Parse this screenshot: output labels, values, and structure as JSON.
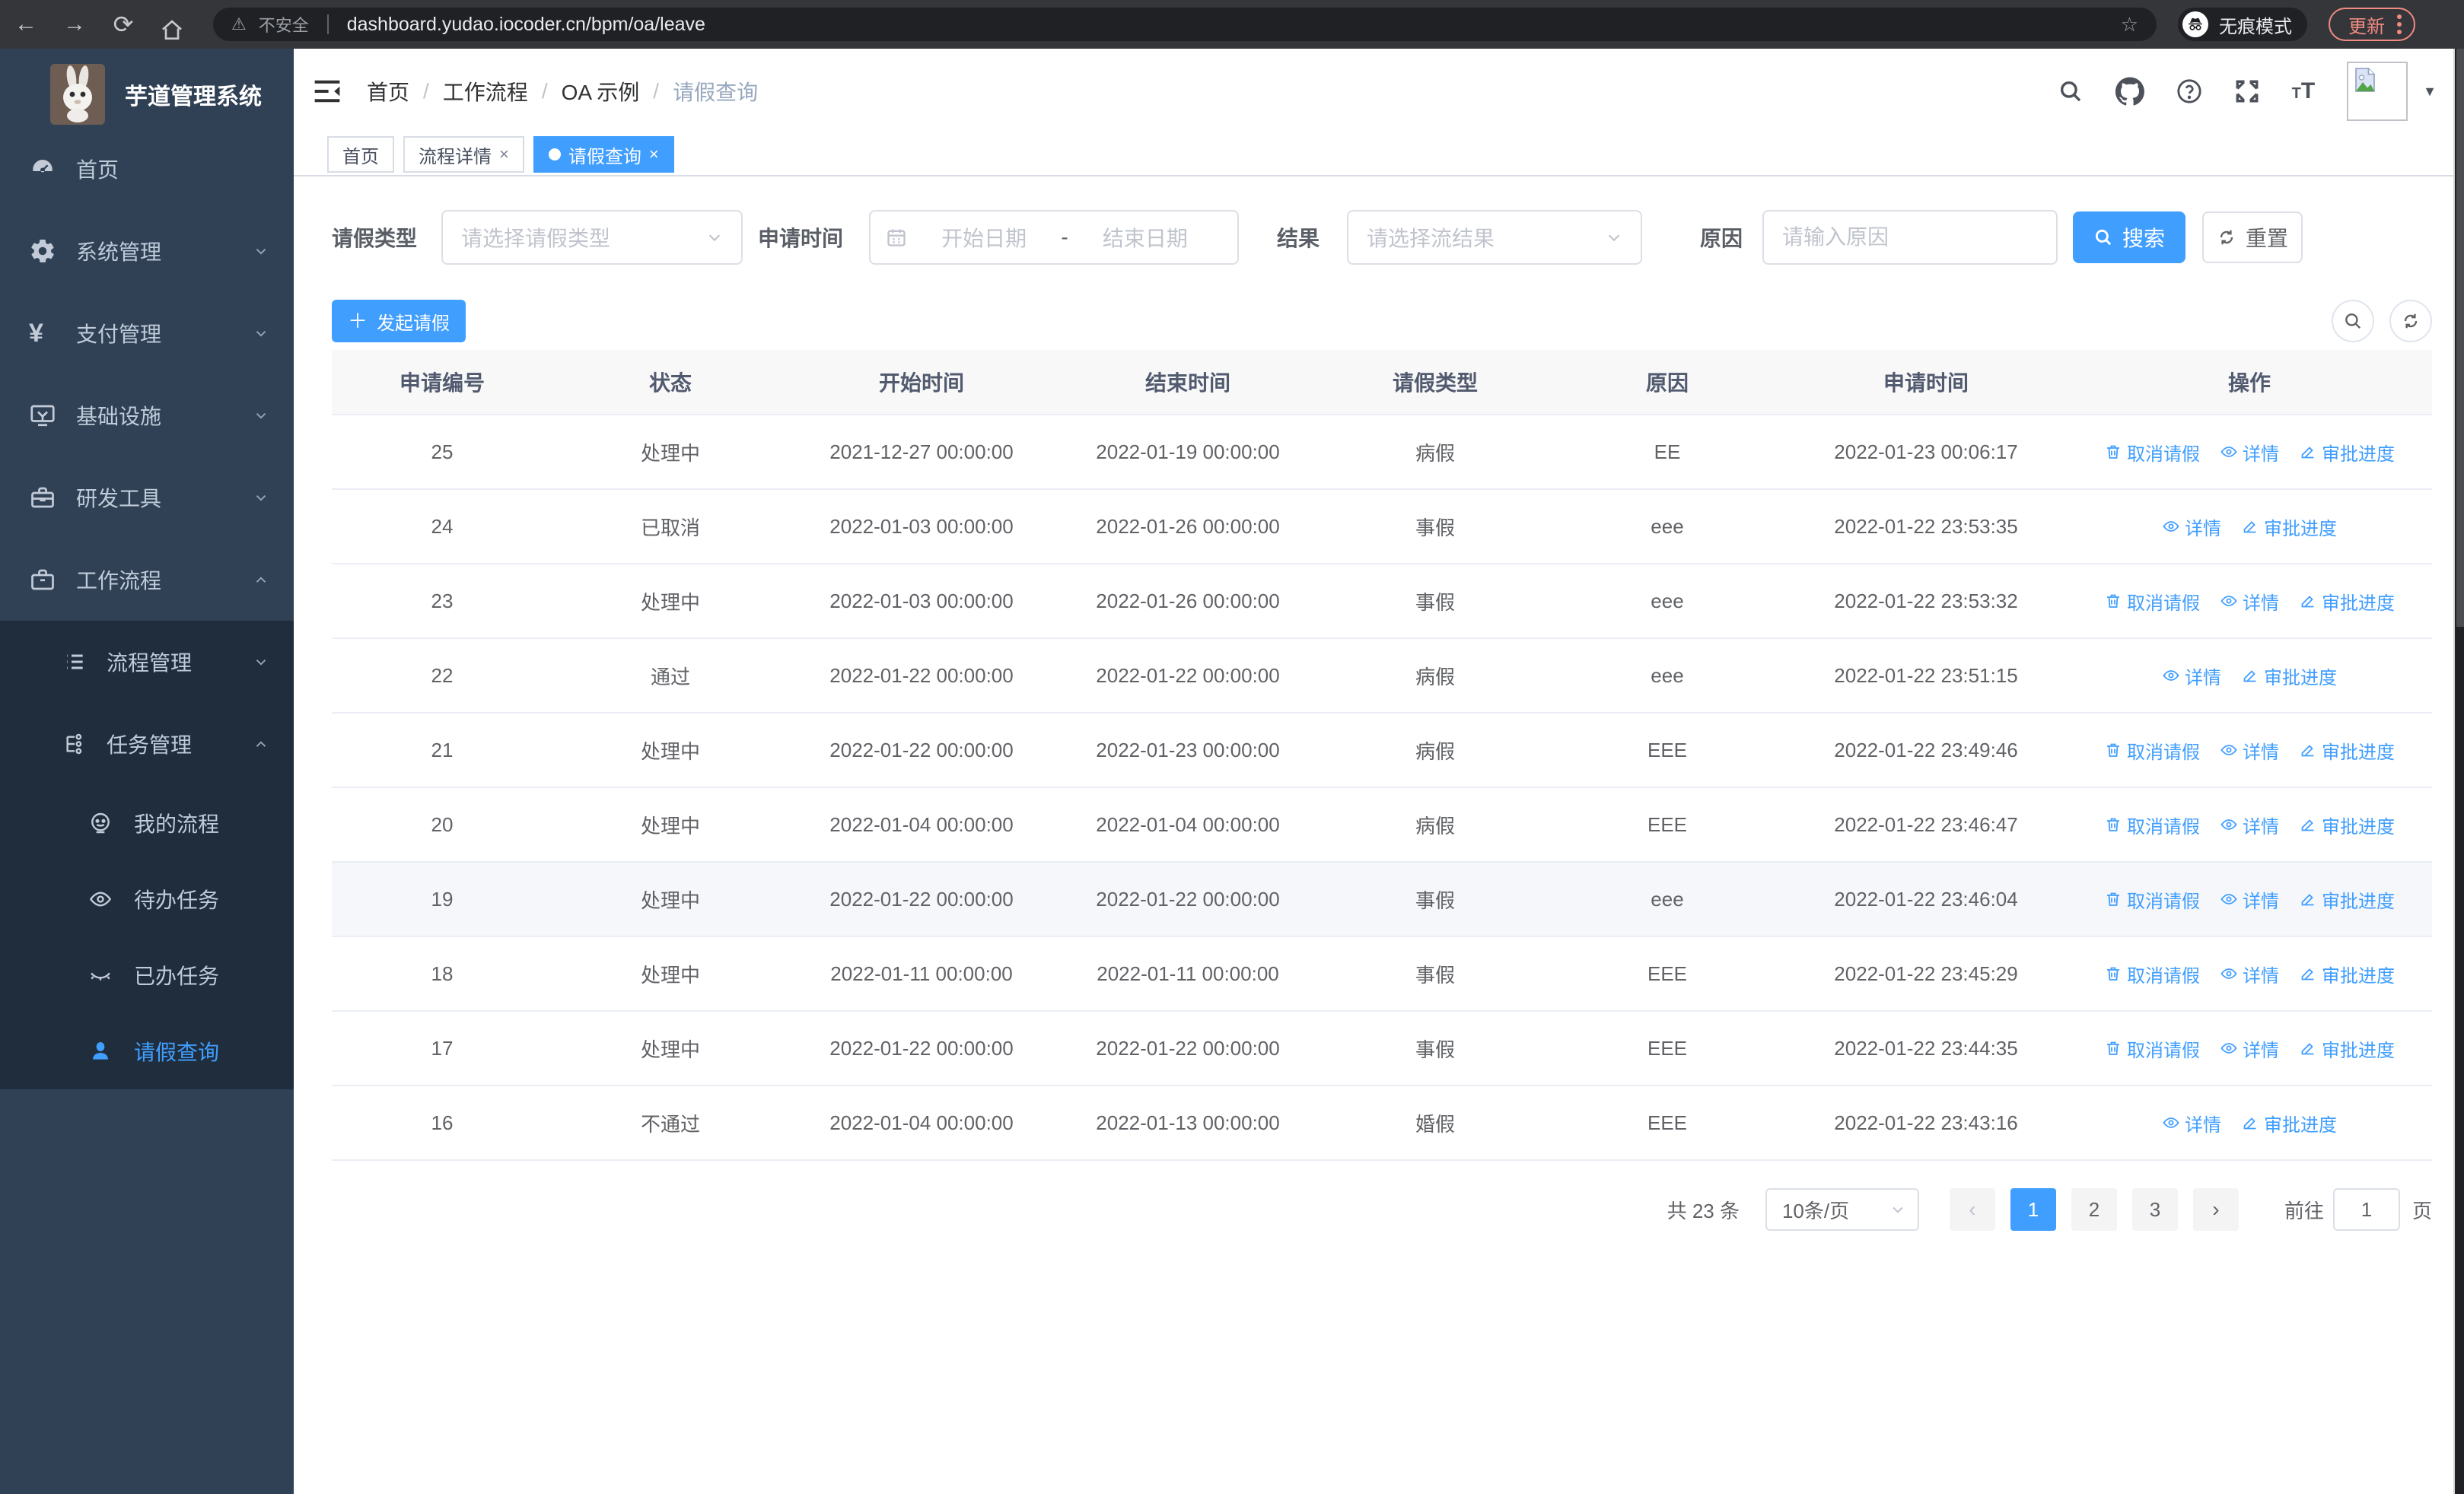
{
  "browser": {
    "security_warning": "不安全",
    "url": "dashboard.yudao.iocoder.cn/bpm/oa/leave",
    "incognito_label": "无痕模式",
    "update_label": "更新"
  },
  "sidebar": {
    "app_title": "芋道管理系统",
    "menu": [
      {
        "label": "首页",
        "icon": "dashboard-icon",
        "level": 1,
        "chevron": "",
        "active": false
      },
      {
        "label": "系统管理",
        "icon": "gear-icon",
        "level": 1,
        "chevron": "down",
        "active": false
      },
      {
        "label": "支付管理",
        "icon": "yen-icon",
        "level": 1,
        "chevron": "down",
        "active": false
      },
      {
        "label": "基础设施",
        "icon": "monitor-icon",
        "level": 1,
        "chevron": "down",
        "active": false
      },
      {
        "label": "研发工具",
        "icon": "toolbox-icon",
        "level": 1,
        "chevron": "down",
        "active": false
      },
      {
        "label": "工作流程",
        "icon": "briefcase-icon",
        "level": 1,
        "chevron": "up",
        "active": false
      },
      {
        "label": "流程管理",
        "icon": "list-icon",
        "level": 2,
        "chevron": "down",
        "active": false
      },
      {
        "label": "任务管理",
        "icon": "flow-icon",
        "level": 2,
        "chevron": "up",
        "active": false
      },
      {
        "label": "我的流程",
        "icon": "face-icon",
        "level": 3,
        "chevron": "",
        "active": false
      },
      {
        "label": "待办任务",
        "icon": "eye-open-icon",
        "level": 3,
        "chevron": "",
        "active": false
      },
      {
        "label": "已办任务",
        "icon": "eye-closed-icon",
        "level": 3,
        "chevron": "",
        "active": false
      },
      {
        "label": "请假查询",
        "icon": "user-icon",
        "level": 3,
        "chevron": "",
        "active": true
      }
    ]
  },
  "header": {
    "breadcrumb": [
      "首页",
      "工作流程",
      "OA 示例",
      "请假查询"
    ]
  },
  "tabs": [
    {
      "label": "首页",
      "closable": false,
      "active": false
    },
    {
      "label": "流程详情",
      "closable": true,
      "active": false
    },
    {
      "label": "请假查询",
      "closable": true,
      "active": true
    }
  ],
  "filters": {
    "type_label": "请假类型",
    "type_placeholder": "请选择请假类型",
    "time_label": "申请时间",
    "start_placeholder": "开始日期",
    "range_separator": "-",
    "end_placeholder": "结束日期",
    "result_label": "结果",
    "result_placeholder": "请选择流结果",
    "reason_label": "原因",
    "reason_placeholder": "请输入原因",
    "search_label": "搜索",
    "reset_label": "重置"
  },
  "toolbar": {
    "create_label": "发起请假"
  },
  "table": {
    "columns": [
      "申请编号",
      "状态",
      "开始时间",
      "结束时间",
      "请假类型",
      "原因",
      "申请时间",
      "操作"
    ],
    "action_labels": {
      "cancel": "取消请假",
      "detail": "详情",
      "progress": "审批进度"
    },
    "rows": [
      {
        "id": "25",
        "status": "处理中",
        "start": "2021-12-27 00:00:00",
        "end": "2022-01-19 00:00:00",
        "type": "病假",
        "reason": "EE",
        "applied": "2022-01-23 00:06:17",
        "actions": [
          "cancel",
          "detail",
          "progress"
        ],
        "highlight": false
      },
      {
        "id": "24",
        "status": "已取消",
        "start": "2022-01-03 00:00:00",
        "end": "2022-01-26 00:00:00",
        "type": "事假",
        "reason": "eee",
        "applied": "2022-01-22 23:53:35",
        "actions": [
          "detail",
          "progress"
        ],
        "highlight": false
      },
      {
        "id": "23",
        "status": "处理中",
        "start": "2022-01-03 00:00:00",
        "end": "2022-01-26 00:00:00",
        "type": "事假",
        "reason": "eee",
        "applied": "2022-01-22 23:53:32",
        "actions": [
          "cancel",
          "detail",
          "progress"
        ],
        "highlight": false
      },
      {
        "id": "22",
        "status": "通过",
        "start": "2022-01-22 00:00:00",
        "end": "2022-01-22 00:00:00",
        "type": "病假",
        "reason": "eee",
        "applied": "2022-01-22 23:51:15",
        "actions": [
          "detail",
          "progress"
        ],
        "highlight": false
      },
      {
        "id": "21",
        "status": "处理中",
        "start": "2022-01-22 00:00:00",
        "end": "2022-01-23 00:00:00",
        "type": "病假",
        "reason": "EEE",
        "applied": "2022-01-22 23:49:46",
        "actions": [
          "cancel",
          "detail",
          "progress"
        ],
        "highlight": false
      },
      {
        "id": "20",
        "status": "处理中",
        "start": "2022-01-04 00:00:00",
        "end": "2022-01-04 00:00:00",
        "type": "病假",
        "reason": "EEE",
        "applied": "2022-01-22 23:46:47",
        "actions": [
          "cancel",
          "detail",
          "progress"
        ],
        "highlight": false
      },
      {
        "id": "19",
        "status": "处理中",
        "start": "2022-01-22 00:00:00",
        "end": "2022-01-22 00:00:00",
        "type": "事假",
        "reason": "eee",
        "applied": "2022-01-22 23:46:04",
        "actions": [
          "cancel",
          "detail",
          "progress"
        ],
        "highlight": true
      },
      {
        "id": "18",
        "status": "处理中",
        "start": "2022-01-11 00:00:00",
        "end": "2022-01-11 00:00:00",
        "type": "事假",
        "reason": "EEE",
        "applied": "2022-01-22 23:45:29",
        "actions": [
          "cancel",
          "detail",
          "progress"
        ],
        "highlight": false
      },
      {
        "id": "17",
        "status": "处理中",
        "start": "2022-01-22 00:00:00",
        "end": "2022-01-22 00:00:00",
        "type": "事假",
        "reason": "EEE",
        "applied": "2022-01-22 23:44:35",
        "actions": [
          "cancel",
          "detail",
          "progress"
        ],
        "highlight": false
      },
      {
        "id": "16",
        "status": "不通过",
        "start": "2022-01-04 00:00:00",
        "end": "2022-01-13 00:00:00",
        "type": "婚假",
        "reason": "EEE",
        "applied": "2022-01-22 23:43:16",
        "actions": [
          "detail",
          "progress"
        ],
        "highlight": false
      }
    ]
  },
  "pagination": {
    "total_label": "共 23 条",
    "page_size": "10条/页",
    "prev": "‹",
    "next": "›",
    "pages": [
      "1",
      "2",
      "3"
    ],
    "active_page": "1",
    "goto_label": "前往",
    "goto_value": "1",
    "page_unit": "页"
  },
  "colors": {
    "primary": "#409eff",
    "sidebar": "#304156",
    "submenu": "#1f2d3d"
  }
}
